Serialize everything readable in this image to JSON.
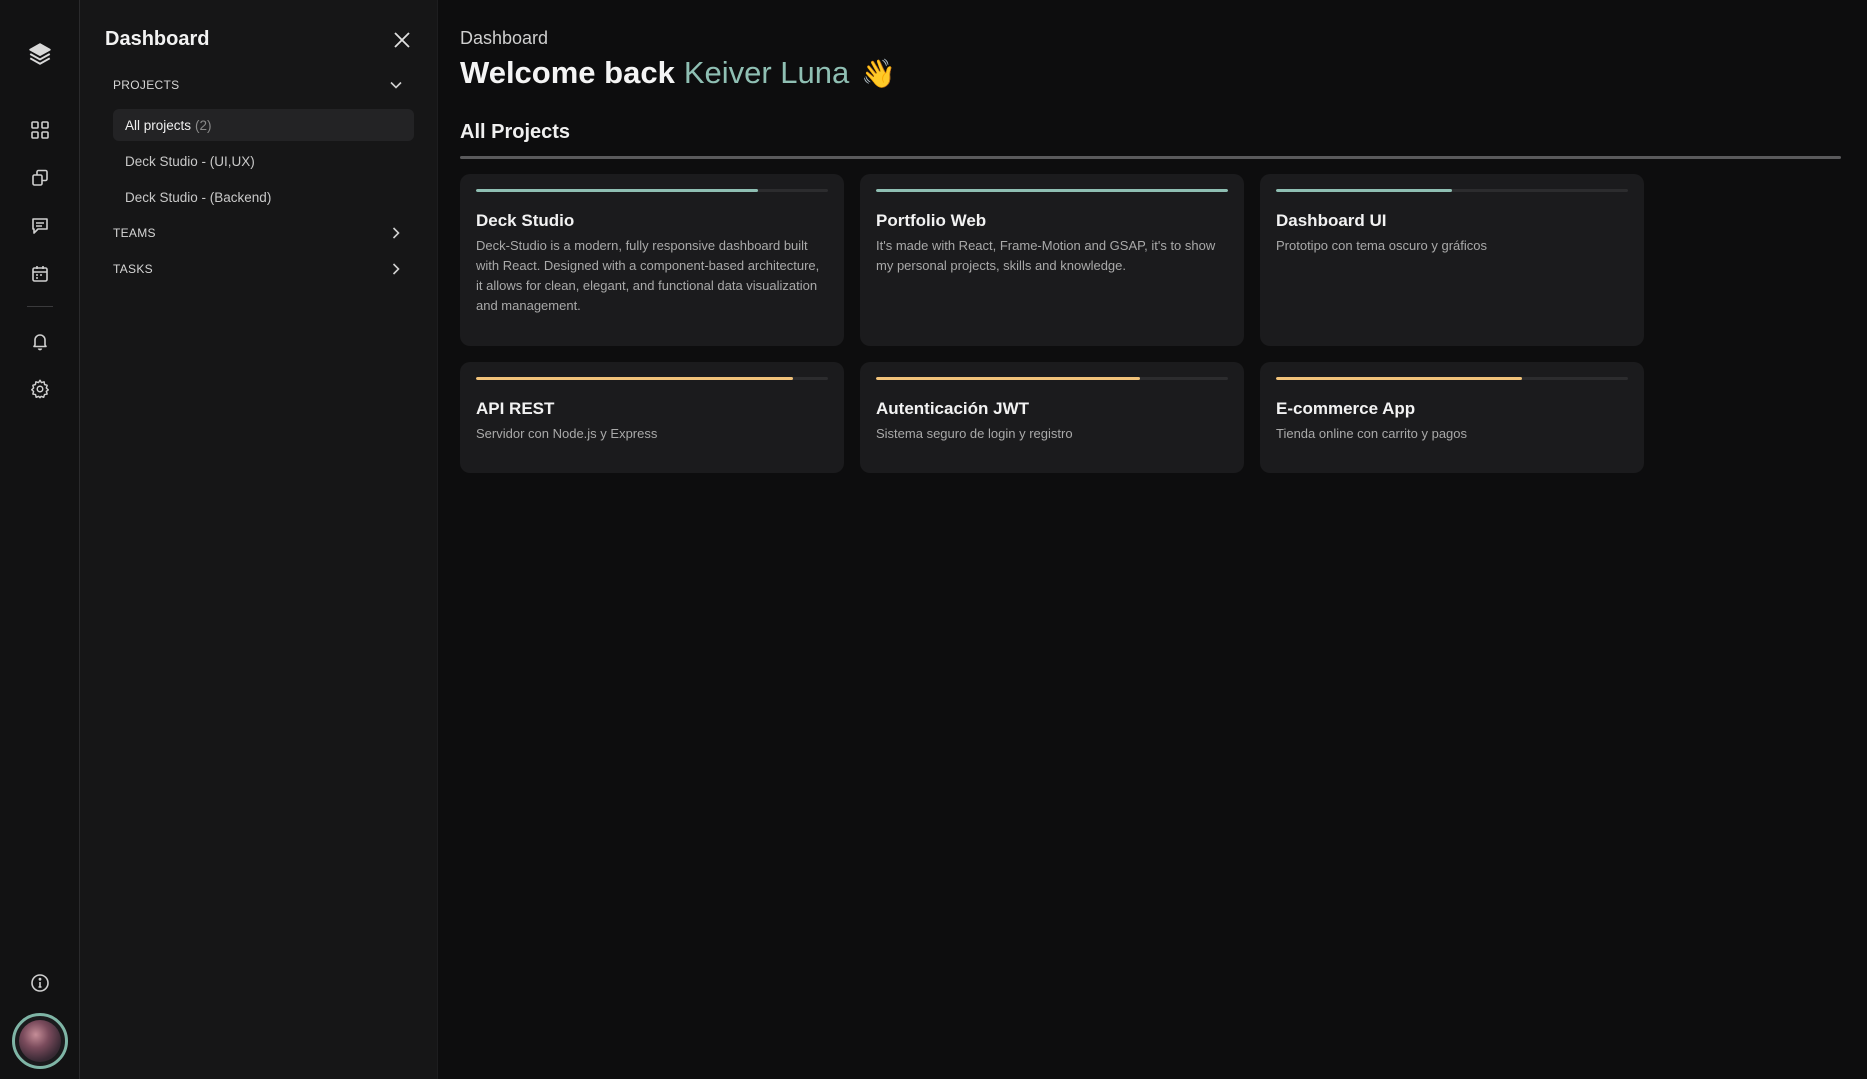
{
  "sidebar": {
    "title": "Dashboard",
    "sections": {
      "projects": {
        "label": "PROJECTS",
        "items": [
          {
            "label": "All projects",
            "count": "(2)"
          },
          {
            "label": "Deck Studio - (UI,UX)"
          },
          {
            "label": "Deck Studio - (Backend)"
          }
        ]
      },
      "teams": {
        "label": "TEAMS"
      },
      "tasks": {
        "label": "TASKS"
      }
    }
  },
  "rail": {
    "icons": [
      "layers-icon",
      "grid-icon",
      "copy-icon",
      "chat-icon",
      "calendar-icon",
      "bell-icon",
      "gear-icon",
      "info-icon",
      "avatar"
    ]
  },
  "main": {
    "breadcrumb": "Dashboard",
    "welcome": "Welcome back",
    "user_name": "Keiver Luna",
    "wave": "👋",
    "section_title": "All Projects"
  },
  "colors": {
    "teal": "#8fbfb3",
    "amber": "#f1c27a",
    "card_bg": "#1b1b1d"
  },
  "projects": [
    {
      "title": "Deck Studio",
      "desc": "Deck-Studio is a modern, fully responsive dashboard built with React. Designed with a component-based architecture, it allows for clean, elegant, and functional data visualization and management.",
      "progress": 0.8,
      "color": "#8fbfb3"
    },
    {
      "title": "Portfolio Web",
      "desc": "It's made with React, Frame-Motion and GSAP, it's to show my personal projects, skills and knowledge.",
      "progress": 1.0,
      "color": "#8fbfb3"
    },
    {
      "title": "Dashboard UI",
      "desc": "Prototipo con tema oscuro y gráficos",
      "progress": 0.5,
      "color": "#8fbfb3"
    },
    {
      "title": "API REST",
      "desc": "Servidor con Node.js y Express",
      "progress": 0.9,
      "color": "#f1c27a"
    },
    {
      "title": "Autenticación JWT",
      "desc": "Sistema seguro de login y registro",
      "progress": 0.75,
      "color": "#f1c27a"
    },
    {
      "title": "E-commerce App",
      "desc": "Tienda online con carrito y pagos",
      "progress": 0.7,
      "color": "#f1c27a"
    }
  ]
}
